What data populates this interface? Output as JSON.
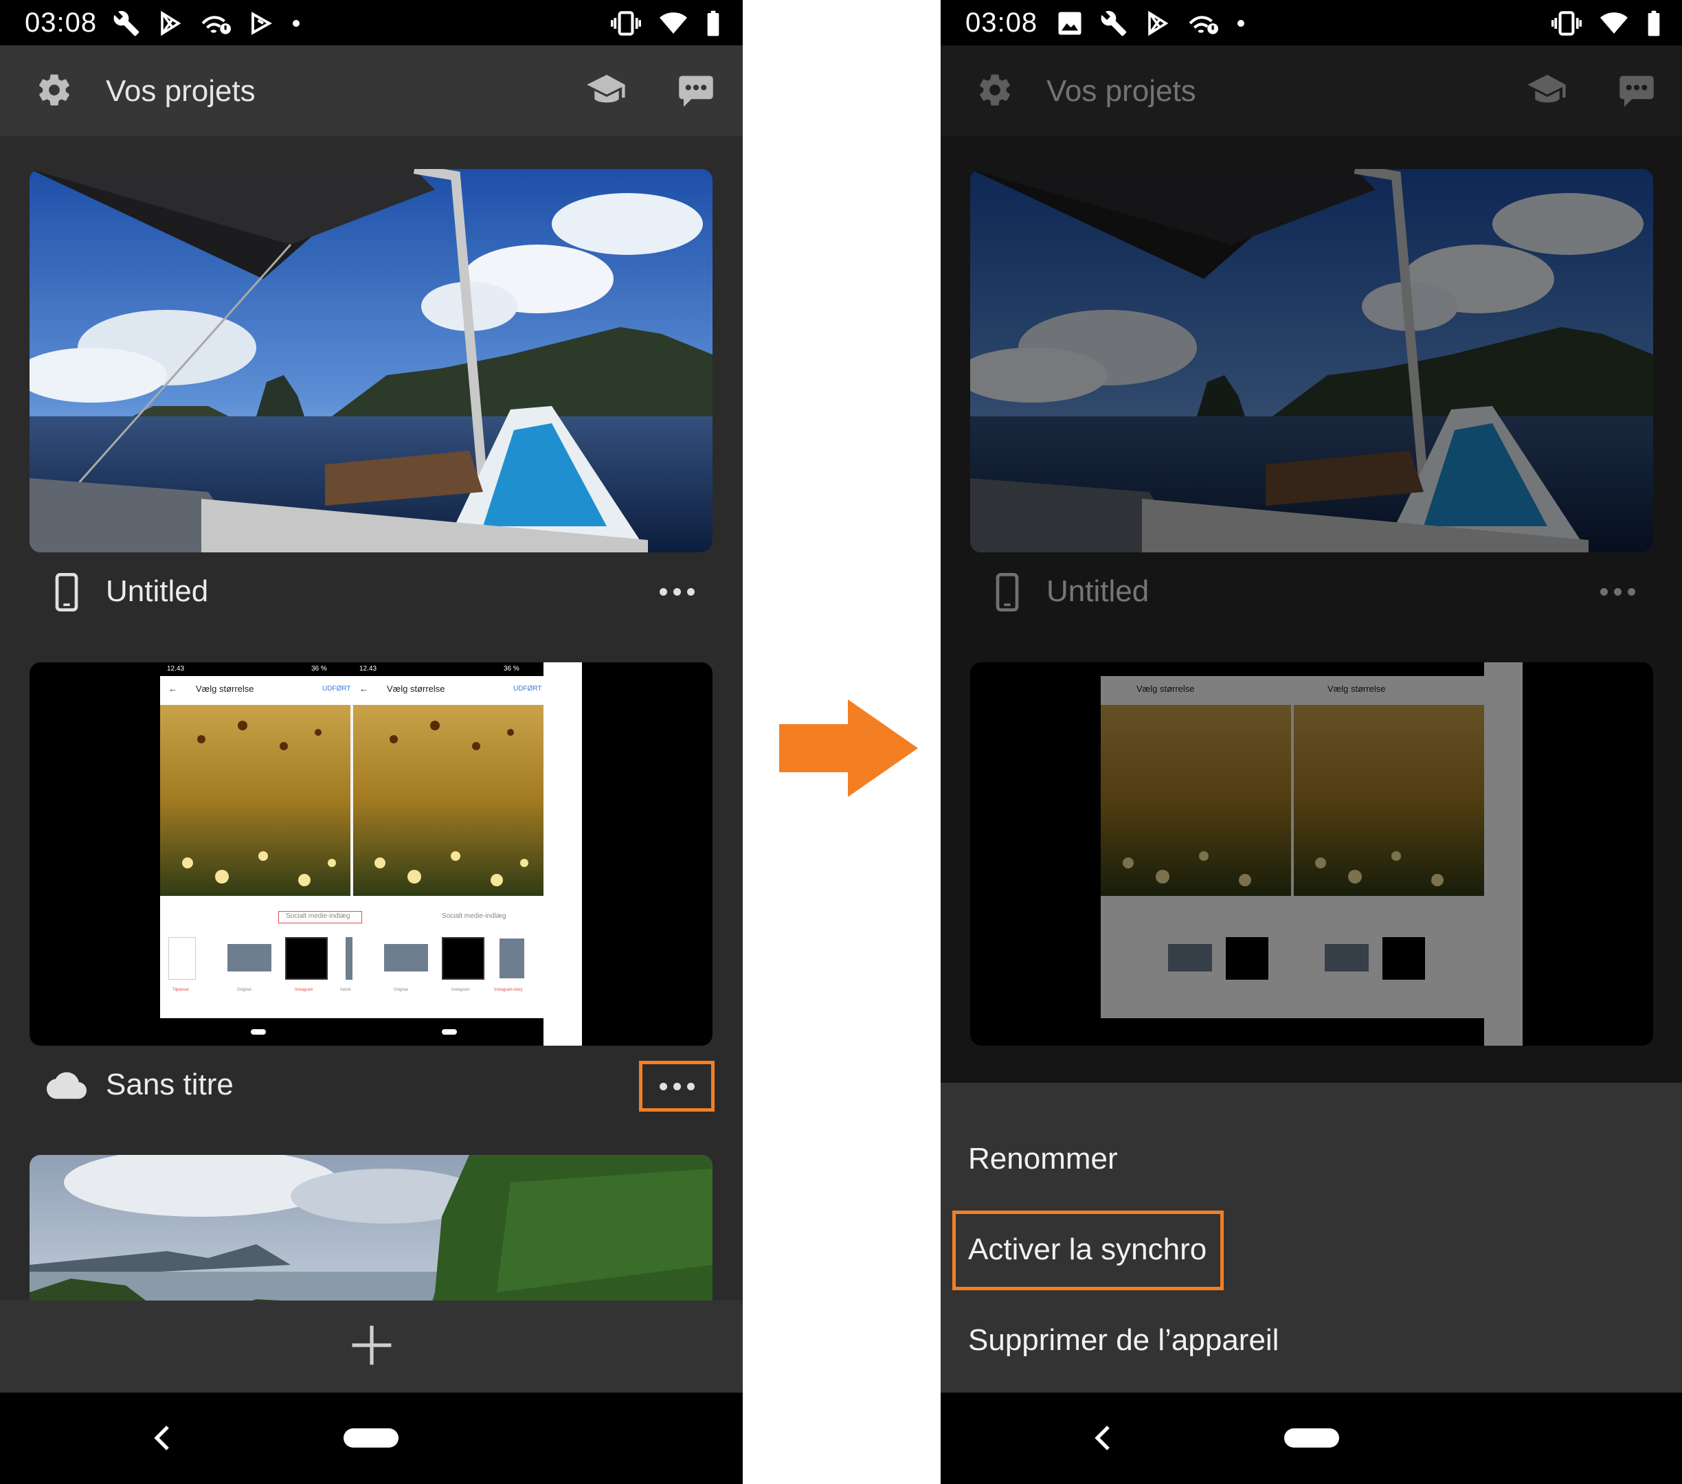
{
  "status": {
    "time": "03:08"
  },
  "appbar": {
    "title": "Vos projets"
  },
  "projects": [
    {
      "name": "Untitled",
      "storage": "phone-icon"
    },
    {
      "name": "Sans titre",
      "storage": "cloud-icon"
    }
  ],
  "thumbnail_screenshot": {
    "time": "12.43",
    "battery": "36 %",
    "title": "Vælg størrelse",
    "done": "UDFØRT",
    "section_active": "Socialt medie-indlæg",
    "section": "Socialt medie-indlæg",
    "labels": [
      "Tilpasset",
      "Original",
      "Instagram",
      "Indstil",
      "Original",
      "Instagram",
      "Instagram-story"
    ]
  },
  "menu": {
    "rename": "Renommer",
    "enable_sync": "Activer la synchro",
    "delete": "Supprimer de l’appareil"
  },
  "colors": {
    "accent": "#f47f23",
    "background": "#2b2b2b",
    "appbar": "#363636",
    "sheet": "#333333"
  }
}
